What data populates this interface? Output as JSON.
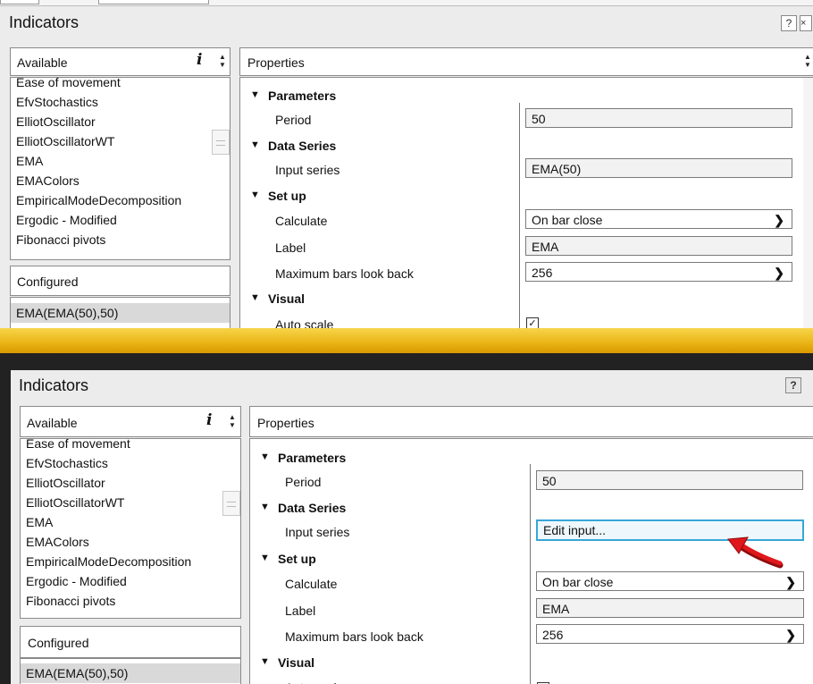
{
  "dialog": {
    "title": "Indicators",
    "help_label": "?",
    "close_label": "×"
  },
  "available": {
    "header": "Available",
    "info_label": "i",
    "items": [
      "Ease of movement",
      "EfvStochastics",
      "ElliotOscillator",
      "ElliotOscillatorWT",
      "EMA",
      "EMAColors",
      "EmpiricalModeDecomposition",
      "Ergodic - Modified",
      "Fibonacci pivots"
    ]
  },
  "configured": {
    "header": "Configured",
    "items": [
      "EMA(EMA(50),50)"
    ]
  },
  "properties": {
    "header": "Properties",
    "categories": {
      "parameters": "Parameters",
      "data_series": "Data Series",
      "set_up": "Set up",
      "visual": "Visual"
    },
    "labels": {
      "period": "Period",
      "input_series": "Input series",
      "calculate": "Calculate",
      "label": "Label",
      "max_bars": "Maximum bars look back",
      "auto_scale": "Auto scale"
    }
  },
  "before": {
    "period": "50",
    "input_series": "EMA(50)",
    "calculate": "On bar close",
    "label": "EMA",
    "max_bars": "256",
    "auto_scale_checked": true
  },
  "after": {
    "period": "50",
    "input_series": "Edit input...",
    "calculate": "On bar close",
    "label": "EMA",
    "max_bars": "256",
    "auto_scale_checked": true
  },
  "colors": {
    "highlight_border": "#37a6d8",
    "arrow": "#e0171b",
    "separator": "#eab315"
  },
  "icons": {
    "chevron": "chevron-down-icon",
    "expand": "triangle-down-icon",
    "spinner": "up-down-spinner-icon",
    "arrow": "red-pointer-arrow-icon",
    "check": "checkmark-icon"
  }
}
